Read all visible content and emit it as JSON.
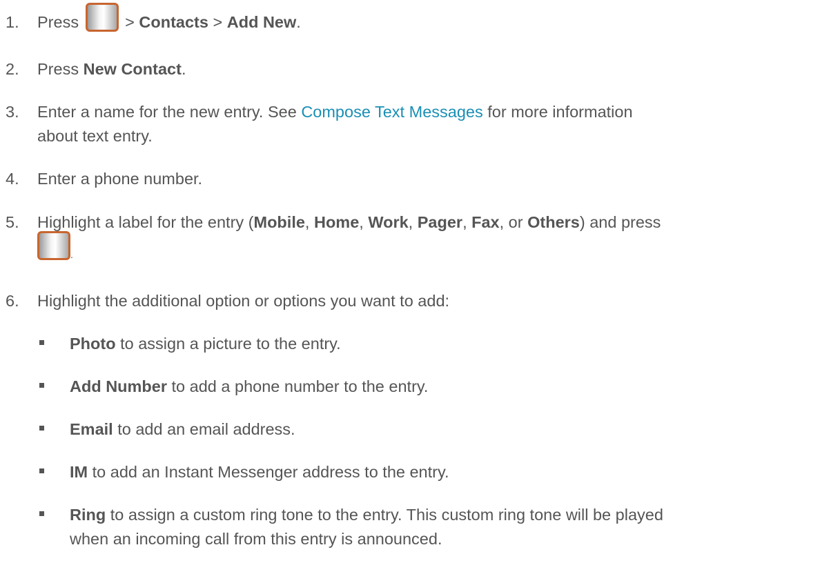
{
  "steps": [
    {
      "num": "1.",
      "press": "Press",
      "sep1": ">",
      "contacts": "Contacts",
      "sep2": ">",
      "add_new": "Add New",
      "end": "."
    },
    {
      "num": "2.",
      "press": "Press",
      "new_contact": "New Contact",
      "end": "."
    },
    {
      "num": "3.",
      "text_a": "Enter a name for the new entry. See",
      "link": "Compose Text Messages",
      "text_b": "for more information",
      "text_c": "about text entry."
    },
    {
      "num": "4.",
      "text": "Enter a phone number."
    },
    {
      "num": "5.",
      "text_a": "Highlight a label for the entry (",
      "mobile": "Mobile",
      "c1": ",",
      "home": "Home",
      "c2": ",",
      "work": "Work",
      "c3": ",",
      "pager": "Pager",
      "c4": ",",
      "fax": "Fax",
      "c5": ", or",
      "others": "Others",
      "text_b": ") and press",
      "end": "."
    },
    {
      "num": "6.",
      "text": "Highlight the additional option or options you want to add:"
    }
  ],
  "options": [
    {
      "label": "Photo",
      "desc": "to assign a picture to the entry."
    },
    {
      "label": "Add Number",
      "desc": "to add a phone number to the entry."
    },
    {
      "label": "Email",
      "desc": "to add an email address."
    },
    {
      "label": "IM",
      "desc": "to add an Instant Messenger address to the entry."
    },
    {
      "label": "Ring",
      "desc": "to assign a custom ring tone to the entry. This custom ring tone will be played",
      "desc2": "when an incoming call from this entry is announced."
    }
  ],
  "icons": {
    "menu_key": "menu-key-icon",
    "bullet": "square-bullet-icon"
  },
  "colors": {
    "text": "#555555",
    "link": "#1a8fb5",
    "key_border": "#c8652f"
  }
}
